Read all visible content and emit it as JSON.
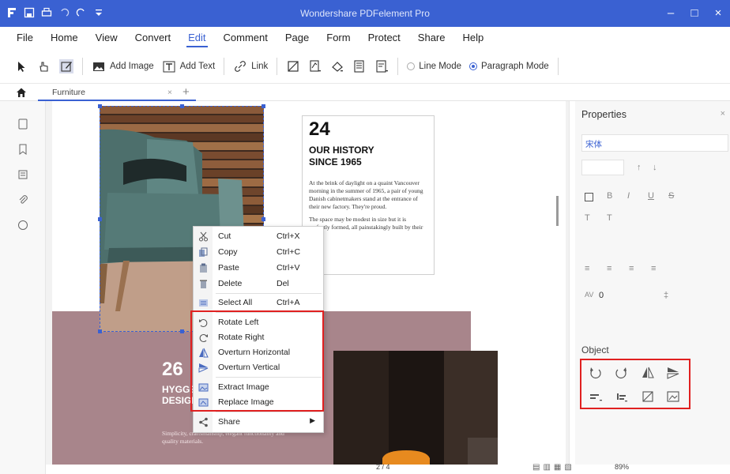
{
  "app": {
    "title": "Wondershare PDFelement Pro",
    "accent": "#3a61d2",
    "highlight": "#e02020"
  },
  "menubar": {
    "items": [
      "File",
      "Home",
      "View",
      "Convert",
      "Edit",
      "Comment",
      "Page",
      "Form",
      "Protect",
      "Share",
      "Help"
    ],
    "active": "Edit"
  },
  "toolbar": {
    "add_image": "Add Image",
    "add_text": "Add Text",
    "link": "Link",
    "line_mode": "Line Mode",
    "paragraph_mode": "Paragraph Mode",
    "paragraph_mode_selected": true
  },
  "tabs": {
    "doc_tab": "Furniture",
    "close": "×",
    "add": "+"
  },
  "document": {
    "tb_number": "24",
    "tb_heading_1": "OUR HISTORY",
    "tb_heading_2": "SINCE 1965",
    "tb_para_1": "At the brink of daylight on a quaint Vancouver morning in the summer of 1965, a pair of young Danish cabinetmakers stand at the entrance of their new factory. They're proud.",
    "tb_para_2": "The space may be modest in size but it is perfectly formed, all painstakingly built by their hands.",
    "section_number": "26",
    "section_heading_1": "HYGGE",
    "section_heading_2": "DESIGN",
    "section_para": "Simplicity, craftsmanship, elegant functionality and quality materials."
  },
  "context_menu": {
    "items": [
      {
        "label": "Cut",
        "shortcut": "Ctrl+X",
        "icon": "scissors-icon"
      },
      {
        "label": "Copy",
        "shortcut": "Ctrl+C",
        "icon": "copy-icon"
      },
      {
        "label": "Paste",
        "shortcut": "Ctrl+V",
        "icon": "paste-icon"
      },
      {
        "label": "Delete",
        "shortcut": "Del",
        "icon": "trash-icon"
      },
      {
        "label": "Select All",
        "shortcut": "Ctrl+A",
        "icon": "select-all-icon"
      },
      {
        "label": "Rotate Left",
        "shortcut": "",
        "icon": "rotate-left-icon"
      },
      {
        "label": "Rotate Right",
        "shortcut": "",
        "icon": "rotate-right-icon"
      },
      {
        "label": "Overturn Horizontal",
        "shortcut": "",
        "icon": "flip-horizontal-icon"
      },
      {
        "label": "Overturn Vertical",
        "shortcut": "",
        "icon": "flip-vertical-icon"
      },
      {
        "label": "Extract Image",
        "shortcut": "",
        "icon": "extract-image-icon"
      },
      {
        "label": "Replace Image",
        "shortcut": "",
        "icon": "replace-image-icon"
      },
      {
        "label": "Share",
        "shortcut": "",
        "icon": "share-icon",
        "submenu": true
      }
    ]
  },
  "properties": {
    "title": "Properties",
    "font_value": "宋体",
    "format_buttons": [
      "B",
      "I",
      "U",
      "S",
      "T",
      "T"
    ],
    "char_spacing_value": "0",
    "object_label": "Object"
  },
  "statusbar": {
    "page": "2 / 4",
    "zoom": "89%"
  }
}
